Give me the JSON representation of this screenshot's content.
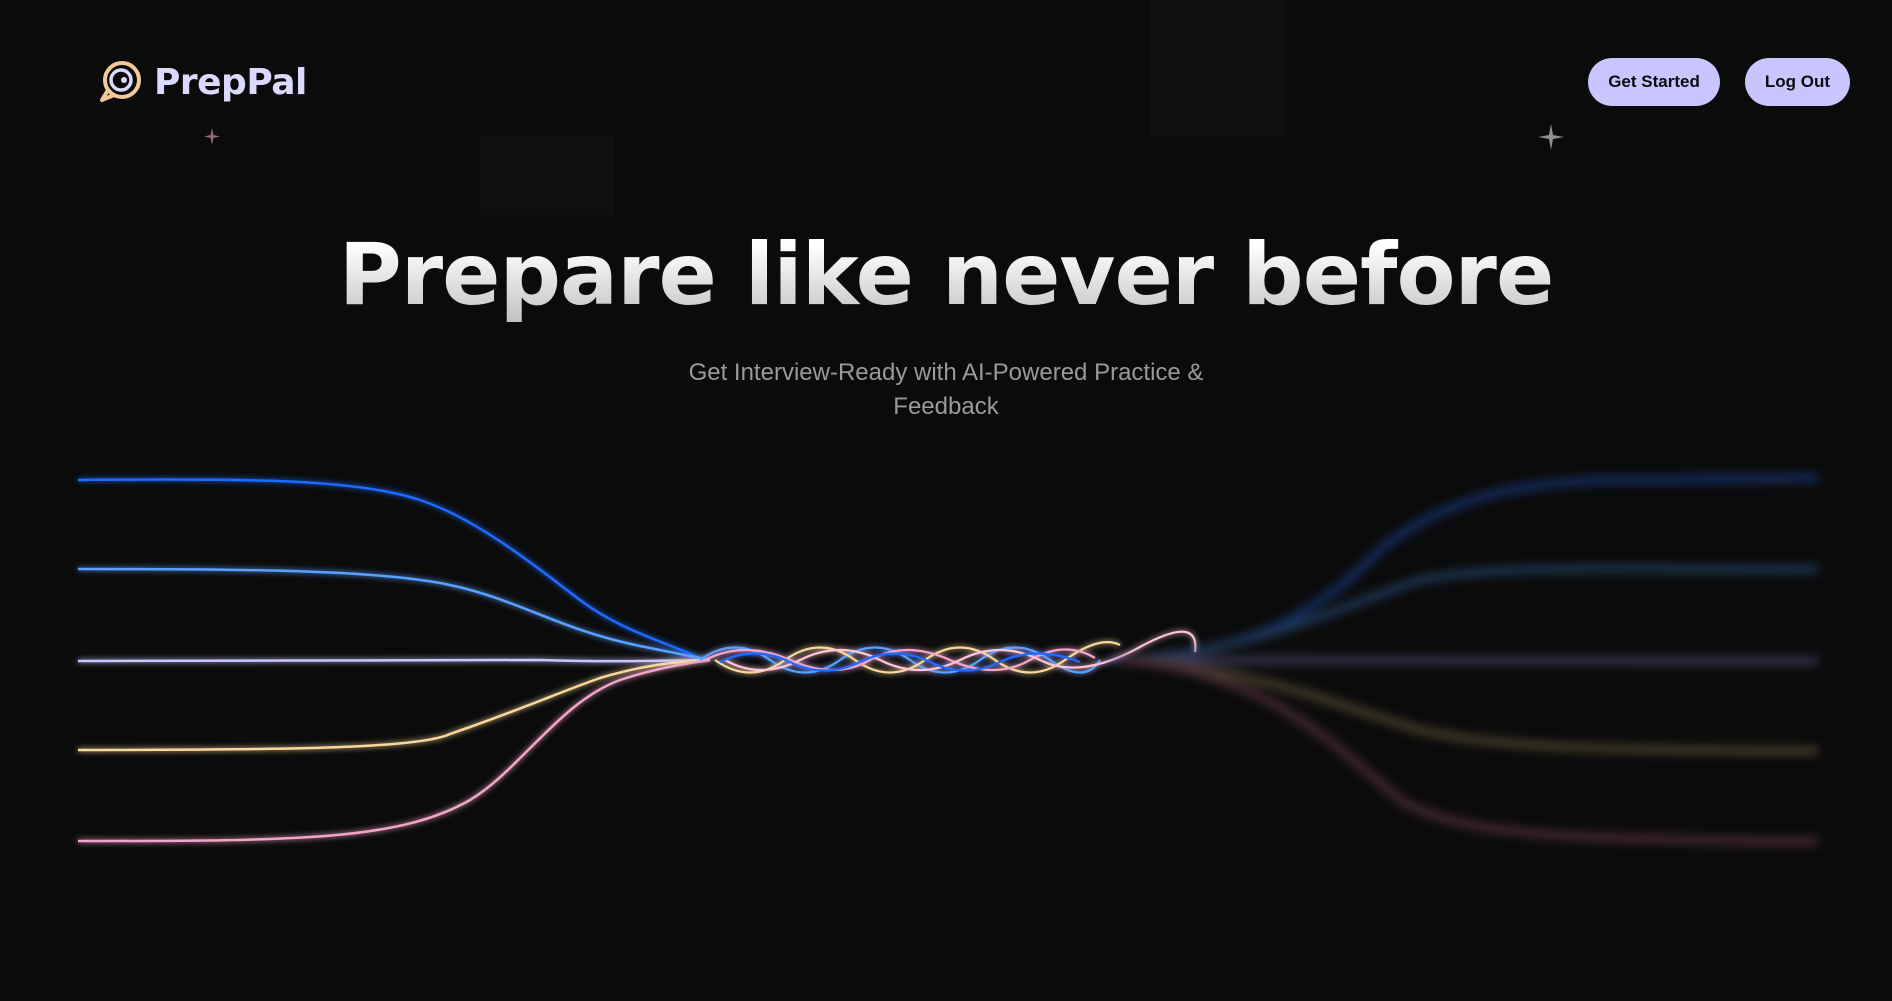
{
  "brand": {
    "name": "PrepPal",
    "logo_icon": "chat-bubble-icon",
    "colors": {
      "text": "#dcd9ff",
      "logo": "#f4c99a"
    }
  },
  "nav": {
    "get_started_label": "Get Started",
    "logout_label": "Log Out",
    "button_color": "#c9c6ff"
  },
  "hero": {
    "title": "Prepare like never before",
    "subtitle": "Get Interview-Ready with AI-Powered Practice & Feedback"
  },
  "decoration": {
    "wave_colors": [
      "#1f6bff",
      "#5aa0ff",
      "#c9c6ff",
      "#f7d79a",
      "#f3a5c8"
    ],
    "background": "#0b0b0b"
  }
}
